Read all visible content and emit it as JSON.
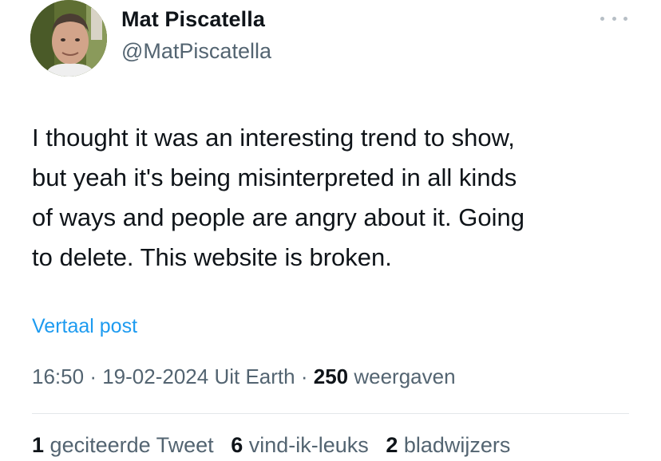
{
  "author": {
    "display_name": "Mat Piscatella",
    "handle": "@MatPiscatella"
  },
  "tweet": {
    "lines": [
      "I thought it was an interesting trend to show,",
      "but yeah it's being misinterpreted in all kinds",
      "of ways and people are angry about it. Going",
      "to delete. This website is broken."
    ],
    "translate_label": "Vertaal post",
    "time": "16:50",
    "separator": "·",
    "date_location": "19-02-2024 Uit Earth",
    "views_count": "250",
    "views_label": "weergaven"
  },
  "stats": {
    "quotes_count": "1",
    "quotes_label": "geciteerde Tweet",
    "likes_count": "6",
    "likes_label": "vind-ik-leuks",
    "bookmarks_count": "2",
    "bookmarks_label": "bladwijzers"
  },
  "icons": {
    "more": "more-horizontal-icon"
  },
  "colors": {
    "link": "#1d9bf0",
    "secondary_text": "#536471",
    "primary_text": "#0f1419"
  }
}
